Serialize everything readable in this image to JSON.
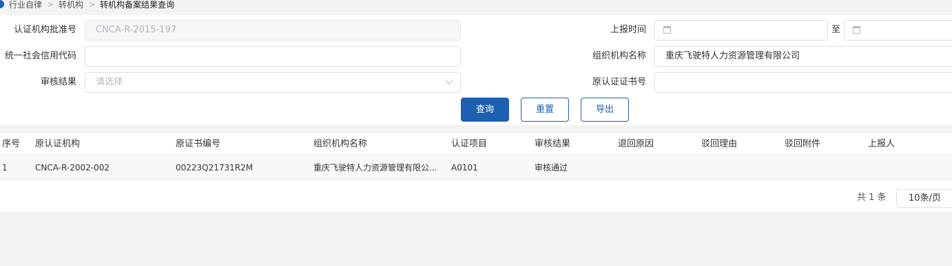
{
  "breadcrumb": {
    "items": [
      "行业自律",
      "转机构",
      "转机构备案结果查询"
    ],
    "separator": ">"
  },
  "form": {
    "approval_no": {
      "label": "认证机构批准号",
      "value": "CNCA-R-2015-197"
    },
    "report_time": {
      "label": "上报时间",
      "to_label": "至"
    },
    "credit_code": {
      "label": "统一社会信用代码",
      "value": ""
    },
    "org_name": {
      "label": "组织机构名称",
      "value": "重庆飞驶特人力资源管理有限公司"
    },
    "review_result": {
      "label": "审核结果",
      "placeholder": "请选择"
    },
    "orig_cert_no": {
      "label": "原认证证书号",
      "value": ""
    }
  },
  "buttons": {
    "query": "查询",
    "reset": "重置",
    "export": "导出"
  },
  "table": {
    "columns": [
      "序号",
      "原认证机构",
      "原证书编号",
      "组织机构名称",
      "认证项目",
      "审核结果",
      "退回原因",
      "驳回理由",
      "驳回附件",
      "上报人"
    ],
    "rows": [
      {
        "index": "1",
        "orig_org": "CNCA-R-2002-002",
        "cert_no": "00223Q21731R2M",
        "org_name": "重庆飞驶特人力资源管理有限公...",
        "project": "A0101",
        "result": "审核通过",
        "return_reason": "",
        "reject_reason": "",
        "reject_attachment": "",
        "reporter": ""
      }
    ]
  },
  "pagination": {
    "total_text": "共 1 条",
    "page_size": "10条/页"
  },
  "colors": {
    "primary": "#1d5fb0",
    "border": "#dcdfe6",
    "background": "#f2f3f2"
  },
  "icons": {
    "date": "calendar-icon",
    "select": "chevron-down-icon",
    "breadcrumb_sep": "chevron-right-icon"
  }
}
